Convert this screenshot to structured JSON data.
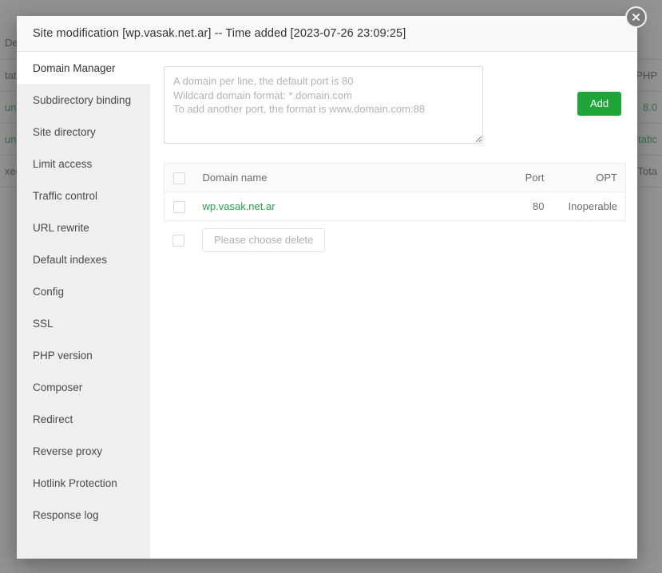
{
  "background": {
    "rows": [
      {
        "left": "Defa",
        "right": ""
      },
      {
        "left": "tatu",
        "right": "PHP"
      },
      {
        "left": "unn",
        "left_color": "green",
        "right": "8.0",
        "right_color": "green"
      },
      {
        "left": "unn",
        "left_color": "green",
        "right": "Static",
        "right_color": "green"
      },
      {
        "left": "xecu",
        "right": "Tota"
      }
    ]
  },
  "dialog": {
    "title": "Site modification [wp.vasak.net.ar] -- Time added [2023-07-26 23:09:25]",
    "close_icon": "close-icon"
  },
  "sidebar": {
    "items": [
      {
        "label": "Domain Manager",
        "active": true
      },
      {
        "label": "Subdirectory binding",
        "active": false
      },
      {
        "label": "Site directory",
        "active": false
      },
      {
        "label": "Limit access",
        "active": false
      },
      {
        "label": "Traffic control",
        "active": false
      },
      {
        "label": "URL rewrite",
        "active": false
      },
      {
        "label": "Default indexes",
        "active": false
      },
      {
        "label": "Config",
        "active": false
      },
      {
        "label": "SSL",
        "active": false
      },
      {
        "label": "PHP version",
        "active": false
      },
      {
        "label": "Composer",
        "active": false
      },
      {
        "label": "Redirect",
        "active": false
      },
      {
        "label": "Reverse proxy",
        "active": false
      },
      {
        "label": "Hotlink Protection",
        "active": false
      },
      {
        "label": "Response log",
        "active": false
      }
    ]
  },
  "main": {
    "textarea": {
      "value": "",
      "placeholder": "A domain per line, the default port is 80\nWildcard domain format: *.domain.com\nTo add another port, the format is www.domain.com:88"
    },
    "add_button": "Add",
    "table": {
      "headers": {
        "domain_name": "Domain name",
        "port": "Port",
        "opt": "OPT"
      },
      "rows": [
        {
          "domain": "wp.vasak.net.ar",
          "port": "80",
          "opt": "Inoperable",
          "checked": false
        }
      ]
    },
    "delete_button": "Please choose delete",
    "select_all_checked": false,
    "footer_checkbox_checked": false
  },
  "colors": {
    "accent_green": "#20a53a",
    "link_green": "#24a148",
    "header_bg": "#f8f8f8",
    "sidebar_bg": "#efefef"
  }
}
